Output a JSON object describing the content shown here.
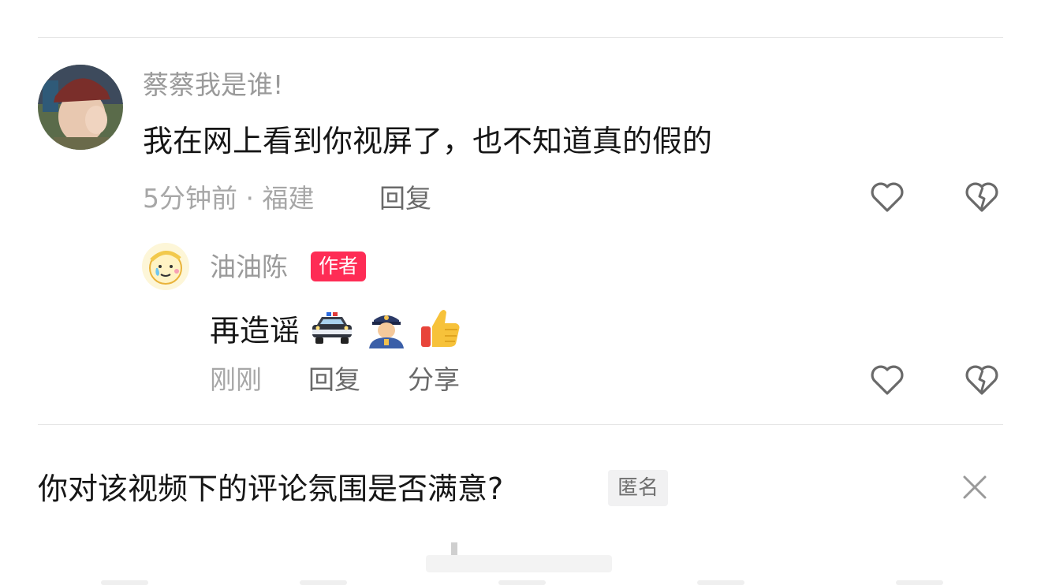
{
  "comment": {
    "username": "蔡蔡我是谁!",
    "text": "我在网上看到你视屏了，也不知道真的假的",
    "meta": "5分钟前 · 福建",
    "reply_label": "回复"
  },
  "reply": {
    "username": "油油陈",
    "author_badge": "作者",
    "text": "再造谣",
    "emojis": [
      "police-car",
      "police-officer",
      "thumbs-up"
    ],
    "time": "刚刚",
    "reply_label": "回复",
    "share_label": "分享"
  },
  "survey": {
    "question": "你对该视频下的评论氛围是否满意?",
    "anonymous_tag": "匿名"
  },
  "colors": {
    "badge": "#fe2c55",
    "text_primary": "#161616",
    "text_secondary": "#9a9a9a"
  }
}
